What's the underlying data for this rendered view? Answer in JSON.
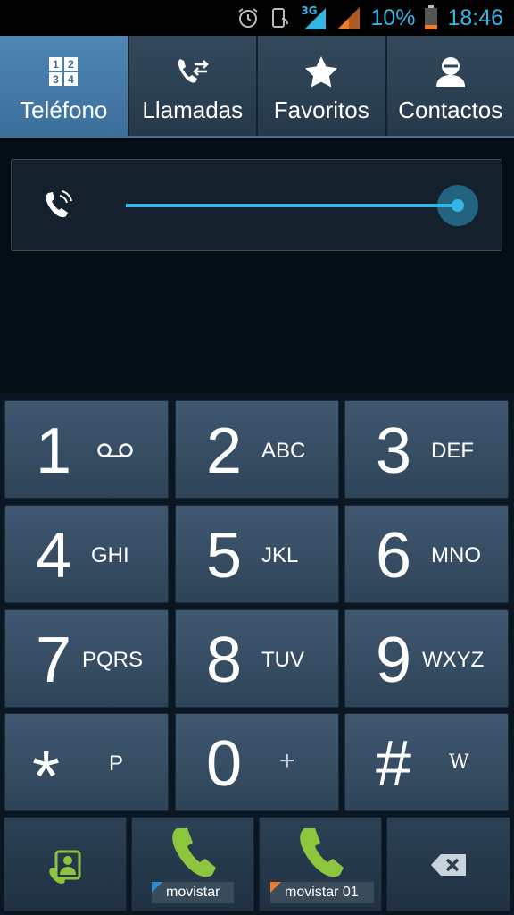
{
  "status_bar": {
    "network_type": "3G",
    "battery_percent": "10%",
    "time": "18:46",
    "icons": [
      "alarm-icon",
      "phone-screen-icon",
      "signal-3g-icon",
      "wifi-signal-icon",
      "battery-low-icon"
    ]
  },
  "tabs": [
    {
      "label": "Teléfono",
      "icon": "keypad-icon",
      "active": true
    },
    {
      "label": "Llamadas",
      "icon": "call-log-icon",
      "active": false
    },
    {
      "label": "Favoritos",
      "icon": "star-icon",
      "active": false
    },
    {
      "label": "Contactos",
      "icon": "contact-icon",
      "active": false
    }
  ],
  "volume": {
    "icon": "phone-volume-icon",
    "level": 1.0
  },
  "keypad": [
    {
      "digit": "1",
      "letters": "",
      "icon": "voicemail-icon"
    },
    {
      "digit": "2",
      "letters": "ABC"
    },
    {
      "digit": "3",
      "letters": "DEF"
    },
    {
      "digit": "4",
      "letters": "GHI"
    },
    {
      "digit": "5",
      "letters": "JKL"
    },
    {
      "digit": "6",
      "letters": "MNO"
    },
    {
      "digit": "7",
      "letters": "PQRS"
    },
    {
      "digit": "8",
      "letters": "TUV"
    },
    {
      "digit": "9",
      "letters": "WXYZ"
    },
    {
      "digit": "*",
      "letters": "P"
    },
    {
      "digit": "0",
      "letters": "+"
    },
    {
      "digit": "#",
      "letters": "W"
    }
  ],
  "bottom_bar": {
    "contacts_button_icon": "add-contact-icon",
    "call_sim1": {
      "icon": "call-icon",
      "label": "movistar",
      "color": "#2b8fd6"
    },
    "call_sim2": {
      "icon": "call-icon",
      "label": "movistar 01",
      "color": "#f07a2b"
    },
    "delete_icon": "backspace-icon"
  },
  "colors": {
    "accent": "#33b5e5",
    "call_green": "#8cc63f",
    "active_tab": "#4a7fab"
  }
}
